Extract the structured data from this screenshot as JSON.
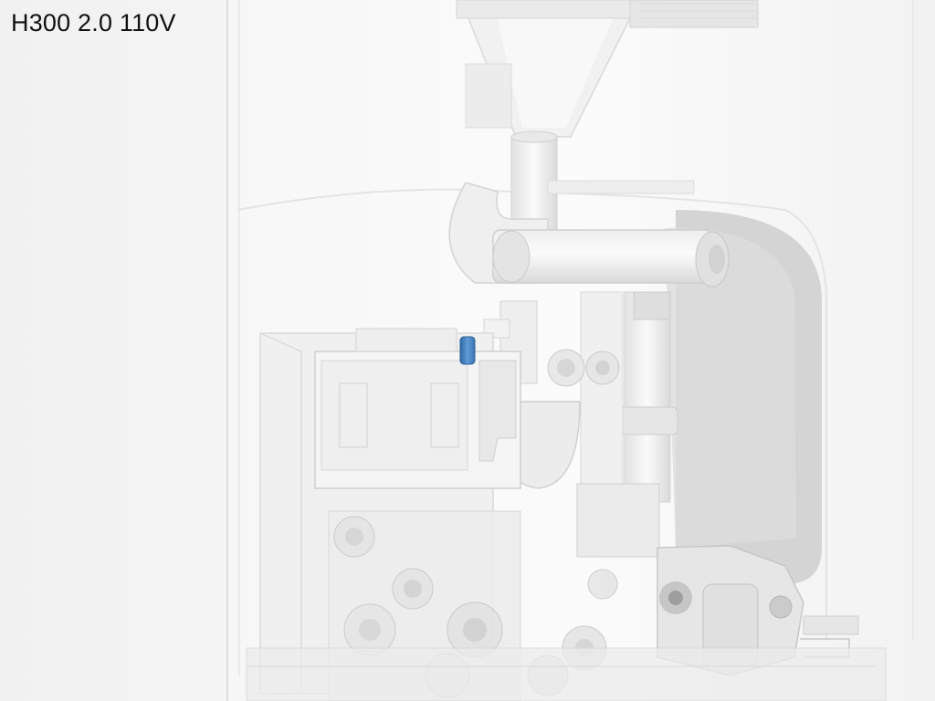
{
  "title": "H300 2.0 110V",
  "colors": {
    "background": "#f3f3f3",
    "housing": "#ffffff",
    "shadow": "#d6d6d6",
    "accent_seal": "#4a86c5"
  }
}
